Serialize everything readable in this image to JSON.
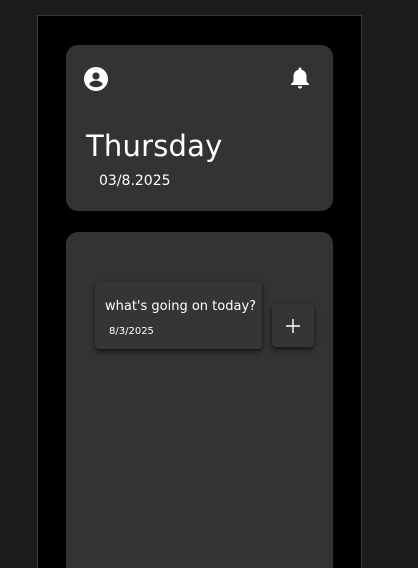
{
  "colors": {
    "page_background": "#1c1c1e",
    "phone_background": "#000000",
    "card_background": "#333333",
    "text": "#ffffff"
  },
  "header": {
    "profile_icon": "account-circle-icon",
    "notification_icon": "bell-icon",
    "day": "Thursday",
    "date": "03/8.2025"
  },
  "tasks": [
    {
      "title": "what's going on today?",
      "date": "8/3/2025"
    }
  ],
  "add_button": {
    "icon": "plus-icon"
  }
}
